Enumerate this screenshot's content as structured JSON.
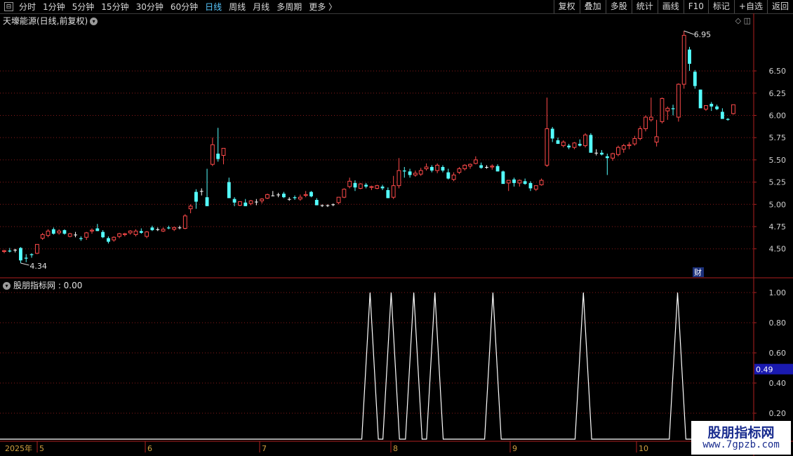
{
  "toolbar": {
    "periods": [
      "分时",
      "1分钟",
      "5分钟",
      "15分钟",
      "30分钟",
      "60分钟",
      "日线",
      "周线",
      "月线",
      "多周期",
      "更多 〉"
    ],
    "active_period": "日线",
    "right_buttons": [
      "复权",
      "叠加",
      "多股",
      "统计",
      "画线",
      "F10",
      "标记",
      "+自选",
      "返回"
    ]
  },
  "main_title": "天壕能源(日线,前复权)",
  "sub_title": "股朋指标网 : 0.00",
  "price_axis": {
    "labels": [
      "6.50",
      "6.25",
      "6.00",
      "5.75",
      "5.50",
      "5.25",
      "5.00",
      "4.75",
      "4.50"
    ]
  },
  "indicator_axis": {
    "labels": [
      "1.00",
      "0.80",
      "0.60",
      "0.40",
      "0.20"
    ],
    "current_value": "0.49"
  },
  "annotations": {
    "high_label": "6.95",
    "low_label": "4.34",
    "cai_badge": "财"
  },
  "date_axis": {
    "labels": [
      "2025年",
      "5",
      "6",
      "7",
      "8",
      "9",
      "10"
    ]
  },
  "colors": {
    "up": "#ff4a4a",
    "down": "#54ffff",
    "flat": "#ffffff",
    "grid": "#8a1a1a",
    "axis": "#b02020",
    "indicator": "#ffffff",
    "highlight_bg": "#1a1ab0"
  },
  "chart_data": {
    "type": "candlestick",
    "ylim": [
      4.25,
      7.0
    ],
    "candles": [
      [
        4.47,
        4.49,
        4.45,
        4.48
      ],
      [
        4.48,
        4.51,
        4.46,
        4.47
      ],
      [
        4.49,
        4.5,
        4.46,
        4.49
      ],
      [
        4.51,
        4.52,
        4.34,
        4.37
      ],
      [
        4.4,
        4.44,
        4.35,
        4.39
      ],
      [
        4.44,
        4.45,
        4.4,
        4.43
      ],
      [
        4.45,
        4.55,
        4.44,
        4.55
      ],
      [
        4.62,
        4.68,
        4.6,
        4.66
      ],
      [
        4.65,
        4.72,
        4.63,
        4.7
      ],
      [
        4.72,
        4.74,
        4.66,
        4.67
      ],
      [
        4.68,
        4.72,
        4.66,
        4.7
      ],
      [
        4.71,
        4.72,
        4.66,
        4.67
      ],
      [
        4.64,
        4.68,
        4.63,
        4.67
      ],
      [
        4.66,
        4.69,
        4.63,
        4.66
      ],
      [
        4.62,
        4.64,
        4.59,
        4.61
      ],
      [
        4.63,
        4.69,
        4.6,
        4.68
      ],
      [
        4.7,
        4.73,
        4.67,
        4.71
      ],
      [
        4.73,
        4.78,
        4.7,
        4.7
      ],
      [
        4.69,
        4.71,
        4.62,
        4.63
      ],
      [
        4.62,
        4.64,
        4.56,
        4.58
      ],
      [
        4.6,
        4.64,
        4.58,
        4.63
      ],
      [
        4.64,
        4.68,
        4.62,
        4.67
      ],
      [
        4.66,
        4.68,
        4.64,
        4.67
      ],
      [
        4.68,
        4.71,
        4.66,
        4.7
      ],
      [
        4.66,
        4.72,
        4.64,
        4.7
      ],
      [
        4.7,
        4.73,
        4.67,
        4.68
      ],
      [
        4.64,
        4.7,
        4.62,
        4.69
      ],
      [
        4.74,
        4.76,
        4.7,
        4.71
      ],
      [
        4.72,
        4.74,
        4.7,
        4.72
      ],
      [
        4.7,
        4.74,
        4.69,
        4.72
      ],
      [
        4.74,
        4.76,
        4.72,
        4.73
      ],
      [
        4.72,
        4.75,
        4.7,
        4.74
      ],
      [
        4.74,
        4.76,
        4.72,
        4.74
      ],
      [
        4.73,
        4.89,
        4.72,
        4.87
      ],
      [
        4.95,
        5.0,
        4.9,
        4.98
      ],
      [
        5.14,
        5.17,
        4.95,
        5.03
      ],
      [
        5.15,
        5.18,
        5.1,
        5.15
      ],
      [
        5.08,
        5.4,
        5.05,
        4.98
      ],
      [
        5.45,
        5.75,
        5.43,
        5.67
      ],
      [
        5.57,
        5.86,
        5.48,
        5.51
      ],
      [
        5.55,
        5.59,
        5.45,
        5.63
      ],
      [
        5.25,
        5.3,
        5.15,
        5.07
      ],
      [
        5.06,
        5.08,
        4.98,
        5.02
      ],
      [
        4.99,
        5.03,
        4.98,
        5.03
      ],
      [
        5.02,
        5.06,
        4.99,
        4.98
      ],
      [
        5.01,
        5.05,
        4.99,
        5.04
      ],
      [
        5.03,
        5.06,
        4.99,
        5.03
      ],
      [
        5.04,
        5.07,
        5.01,
        5.06
      ],
      [
        5.07,
        5.12,
        5.06,
        5.11
      ],
      [
        5.1,
        5.15,
        5.09,
        5.1
      ],
      [
        5.11,
        5.13,
        5.08,
        5.11
      ],
      [
        5.12,
        5.14,
        5.07,
        5.08
      ],
      [
        5.06,
        5.08,
        5.04,
        5.06
      ],
      [
        5.08,
        5.1,
        5.05,
        5.07
      ],
      [
        5.06,
        5.11,
        5.04,
        5.08
      ],
      [
        5.1,
        5.15,
        5.08,
        5.11
      ],
      [
        5.14,
        5.15,
        5.08,
        5.09
      ],
      [
        5.05,
        5.07,
        4.99,
        4.99
      ],
      [
        4.99,
        5.0,
        4.97,
        4.99
      ],
      [
        4.99,
        5.0,
        4.97,
        4.99
      ],
      [
        5.0,
        5.01,
        4.98,
        5.0
      ],
      [
        5.02,
        5.08,
        5.0,
        5.08
      ],
      [
        5.08,
        5.18,
        5.07,
        5.17
      ],
      [
        5.2,
        5.3,
        5.18,
        5.26
      ],
      [
        5.24,
        5.27,
        5.15,
        5.19
      ],
      [
        5.18,
        5.24,
        5.17,
        5.23
      ],
      [
        5.22,
        5.24,
        5.18,
        5.2
      ],
      [
        5.19,
        5.21,
        5.16,
        5.2
      ],
      [
        5.18,
        5.22,
        5.17,
        5.21
      ],
      [
        5.2,
        5.22,
        5.16,
        5.18
      ],
      [
        5.16,
        5.19,
        5.07,
        5.07
      ],
      [
        5.08,
        5.32,
        5.06,
        5.21
      ],
      [
        5.21,
        5.52,
        5.18,
        5.38
      ],
      [
        5.38,
        5.42,
        5.3,
        5.37
      ],
      [
        5.37,
        5.4,
        5.3,
        5.33
      ],
      [
        5.33,
        5.38,
        5.31,
        5.35
      ],
      [
        5.34,
        5.41,
        5.32,
        5.38
      ],
      [
        5.4,
        5.46,
        5.38,
        5.42
      ],
      [
        5.42,
        5.44,
        5.36,
        5.38
      ],
      [
        5.38,
        5.46,
        5.35,
        5.44
      ],
      [
        5.42,
        5.44,
        5.36,
        5.38
      ],
      [
        5.36,
        5.4,
        5.28,
        5.29
      ],
      [
        5.28,
        5.36,
        5.26,
        5.33
      ],
      [
        5.36,
        5.42,
        5.34,
        5.4
      ],
      [
        5.4,
        5.45,
        5.38,
        5.44
      ],
      [
        5.43,
        5.46,
        5.4,
        5.45
      ],
      [
        5.46,
        5.54,
        5.45,
        5.5
      ],
      [
        5.44,
        5.47,
        5.4,
        5.41
      ],
      [
        5.42,
        5.44,
        5.4,
        5.42
      ],
      [
        5.42,
        5.45,
        5.39,
        5.43
      ],
      [
        5.43,
        5.45,
        5.37,
        5.37
      ],
      [
        5.37,
        5.38,
        5.24,
        5.23
      ],
      [
        5.24,
        5.25,
        5.15,
        5.27
      ],
      [
        5.28,
        5.3,
        5.2,
        5.24
      ],
      [
        5.24,
        5.28,
        5.2,
        5.27
      ],
      [
        5.26,
        5.29,
        5.22,
        5.23
      ],
      [
        5.24,
        5.26,
        5.15,
        5.18
      ],
      [
        5.17,
        5.21,
        5.15,
        5.21
      ],
      [
        5.22,
        5.29,
        5.21,
        5.27
      ],
      [
        5.44,
        6.2,
        5.42,
        5.85
      ],
      [
        5.85,
        5.87,
        5.7,
        5.74
      ],
      [
        5.72,
        5.75,
        5.68,
        5.68
      ],
      [
        5.66,
        5.72,
        5.64,
        5.7
      ],
      [
        5.66,
        5.68,
        5.62,
        5.64
      ],
      [
        5.64,
        5.7,
        5.62,
        5.69
      ],
      [
        5.68,
        5.73,
        5.65,
        5.66
      ],
      [
        5.66,
        5.8,
        5.64,
        5.78
      ],
      [
        5.78,
        5.8,
        5.66,
        5.58
      ],
      [
        5.58,
        5.62,
        5.55,
        5.58
      ],
      [
        5.58,
        5.61,
        5.55,
        5.56
      ],
      [
        5.54,
        5.57,
        5.33,
        5.52
      ],
      [
        5.52,
        5.58,
        5.49,
        5.57
      ],
      [
        5.56,
        5.66,
        5.54,
        5.64
      ],
      [
        5.62,
        5.68,
        5.58,
        5.66
      ],
      [
        5.66,
        5.7,
        5.62,
        5.67
      ],
      [
        5.68,
        5.77,
        5.66,
        5.74
      ],
      [
        5.74,
        5.88,
        5.72,
        5.85
      ],
      [
        5.85,
        6.0,
        5.82,
        5.98
      ],
      [
        5.95,
        6.2,
        5.93,
        5.98
      ],
      [
        5.7,
        5.95,
        5.65,
        5.76
      ],
      [
        5.93,
        6.2,
        5.91,
        6.19
      ],
      [
        6.05,
        6.1,
        5.95,
        6.08
      ],
      [
        6.08,
        6.12,
        6.0,
        6.07
      ],
      [
        5.98,
        6.36,
        5.93,
        6.35
      ],
      [
        6.35,
        6.95,
        6.3,
        6.9
      ],
      [
        6.74,
        6.77,
        6.5,
        6.58
      ],
      [
        6.49,
        6.51,
        6.3,
        6.33
      ],
      [
        6.29,
        6.29,
        6.1,
        6.08
      ],
      [
        6.07,
        6.11,
        6.05,
        6.11
      ],
      [
        6.13,
        6.15,
        6.05,
        6.1
      ],
      [
        6.1,
        6.12,
        6.06,
        6.07
      ],
      [
        6.04,
        6.08,
        5.99,
        5.96
      ],
      [
        5.96,
        5.97,
        5.94,
        5.95
      ],
      [
        6.02,
        6.12,
        6.01,
        6.12
      ]
    ],
    "indicator": {
      "description": "0/1 signal series",
      "spikes": [
        {
          "start": 0.48,
          "width": 0.022
        },
        {
          "start": 0.508,
          "width": 0.022
        },
        {
          "start": 0.538,
          "width": 0.022
        },
        {
          "start": 0.566,
          "width": 0.022
        },
        {
          "start": 0.643,
          "width": 0.022
        },
        {
          "start": 0.763,
          "width": 0.022
        },
        {
          "start": 0.888,
          "width": 0.022
        }
      ],
      "ylim": [
        0,
        1.05
      ]
    }
  },
  "watermark": {
    "name": "股朋指标网",
    "url": "www.7gpzb.com"
  }
}
